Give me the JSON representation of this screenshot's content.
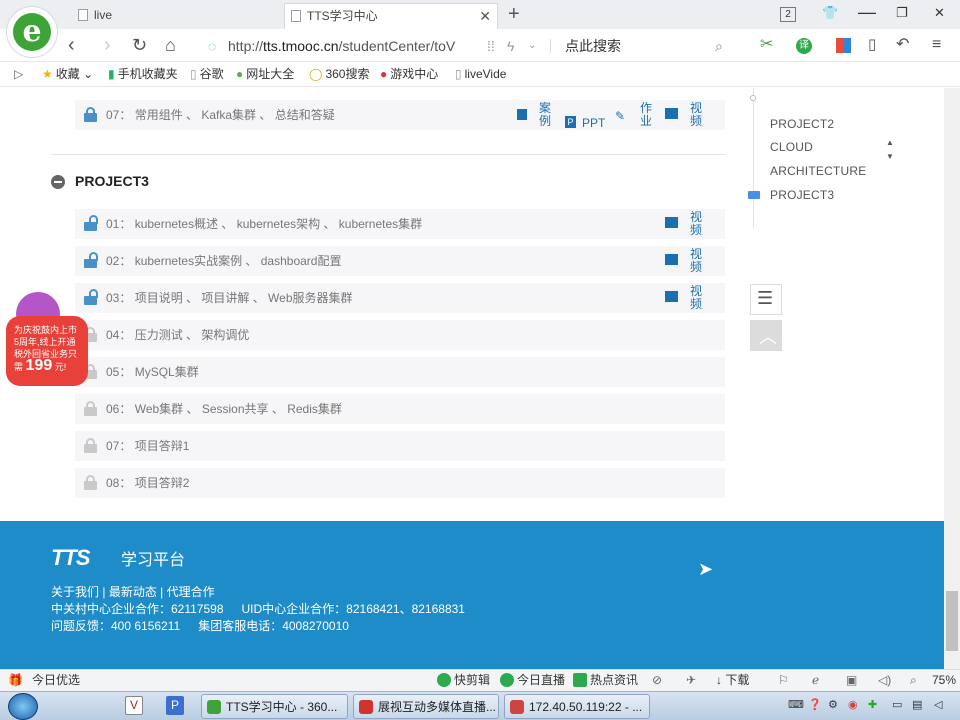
{
  "browser": {
    "tabs": [
      {
        "label": "live"
      },
      {
        "label": "TTS学习中心"
      }
    ],
    "tab_count": "2",
    "url_scheme": "http://",
    "url_host": "tts.tmooc.cn",
    "url_path": "/studentCenter/toV",
    "search_placeholder": "点此搜索",
    "bookmarks": [
      {
        "label": "收藏",
        "icon": "star-icon"
      },
      {
        "label": "手机收藏夹",
        "icon": "phone-icon"
      },
      {
        "label": "谷歌",
        "icon": "folder-icon"
      },
      {
        "label": "网址大全",
        "icon": "site-icon"
      },
      {
        "label": "360搜索",
        "icon": "search360-icon"
      },
      {
        "label": "游戏中心",
        "icon": "game-icon"
      },
      {
        "label": "liveVide",
        "icon": "page-icon"
      }
    ]
  },
  "partial_row": {
    "index": "07：",
    "topics": "常用组件 、 Kafka集群 、 总结和答疑",
    "res": [
      {
        "label": "案例"
      },
      {
        "label": "PPT"
      },
      {
        "label": "作业"
      },
      {
        "label": "视频"
      }
    ]
  },
  "section": {
    "title": "PROJECT3",
    "lessons": [
      {
        "index": "01：",
        "topics": "kubernetes概述 、 kubernetes架构 、 kubernetes集群",
        "locked": false,
        "video": "视频"
      },
      {
        "index": "02：",
        "topics": "kubernetes实战案例 、 dashboard配置",
        "locked": false,
        "video": "视频"
      },
      {
        "index": "03：",
        "topics": "项目说明 、 项目讲解 、 Web服务器集群",
        "locked": false,
        "video": "视频"
      },
      {
        "index": "04：",
        "topics": "压力测试 、 架构调优",
        "locked": true,
        "video": ""
      },
      {
        "index": "05：",
        "topics": "MySQL集群",
        "locked": true,
        "video": ""
      },
      {
        "index": "06：",
        "topics": "Web集群 、 Session共享 、 Redis集群",
        "locked": true,
        "video": ""
      },
      {
        "index": "07：",
        "topics": "项目答辩1",
        "locked": true,
        "video": ""
      },
      {
        "index": "08：",
        "topics": "项目答辩2",
        "locked": true,
        "video": ""
      }
    ]
  },
  "sidenav": {
    "items": [
      {
        "label": "PROJECT2",
        "active": false
      },
      {
        "label": "CLOUD",
        "active": false
      },
      {
        "label": "ARCHITECTURE",
        "active": false
      },
      {
        "label": "PROJECT3",
        "active": true
      }
    ]
  },
  "promo": {
    "line1": "为庆祝鼓内上市",
    "line2": "5周年,线上开通",
    "line3": "税外回省业务只",
    "line4_pre": "需",
    "price": "199",
    "line4_post": "元!"
  },
  "footer": {
    "logo": "TTS",
    "platform": "学习平台",
    "links": [
      "关于我们",
      "最新动态",
      "代理合作"
    ],
    "line2a": "中关村中心企业合作：62117598",
    "line2b": "UID中心企业合作：82168421、82168831",
    "line3a": "问题反馈：400 6156211",
    "line3b": "集团客服电话：4008270010"
  },
  "statusbar": {
    "left": "今日优选",
    "items": [
      "快剪辑",
      "今日直播",
      "热点资讯",
      "下载"
    ],
    "zoom": "75%"
  },
  "taskbar": {
    "windows": [
      {
        "label": "TTS学习中心 - 360..."
      },
      {
        "label": "展视互动多媒体直播..."
      },
      {
        "label": "172.40.50.119:22 - ..."
      }
    ]
  },
  "colors": {
    "footer_bg": "#1e8cc8",
    "accent_blue": "#1a6fb0",
    "unlock_blue": "#4a90c8",
    "locked_gray": "#c9c9c9",
    "row_bg": "#f6f6f8"
  }
}
